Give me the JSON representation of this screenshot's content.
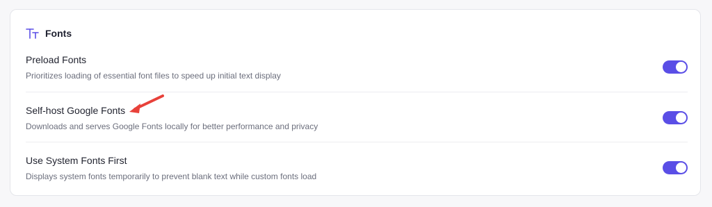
{
  "section": {
    "title": "Fonts",
    "icon": "font-size-icon",
    "accent_color": "#5a4ee6"
  },
  "settings": [
    {
      "label": "Preload Fonts",
      "description": "Prioritizes loading of essential font files to speed up initial text display",
      "enabled": true
    },
    {
      "label": "Self-host Google Fonts",
      "description": "Downloads and serves Google Fonts locally for better performance and privacy",
      "enabled": true
    },
    {
      "label": "Use System Fonts First",
      "description": "Displays system fonts temporarily to prevent blank text while custom fonts load",
      "enabled": true
    }
  ],
  "annotation": {
    "arrow_color": "#e8413a",
    "arrow_target": "Self-host Google Fonts"
  }
}
